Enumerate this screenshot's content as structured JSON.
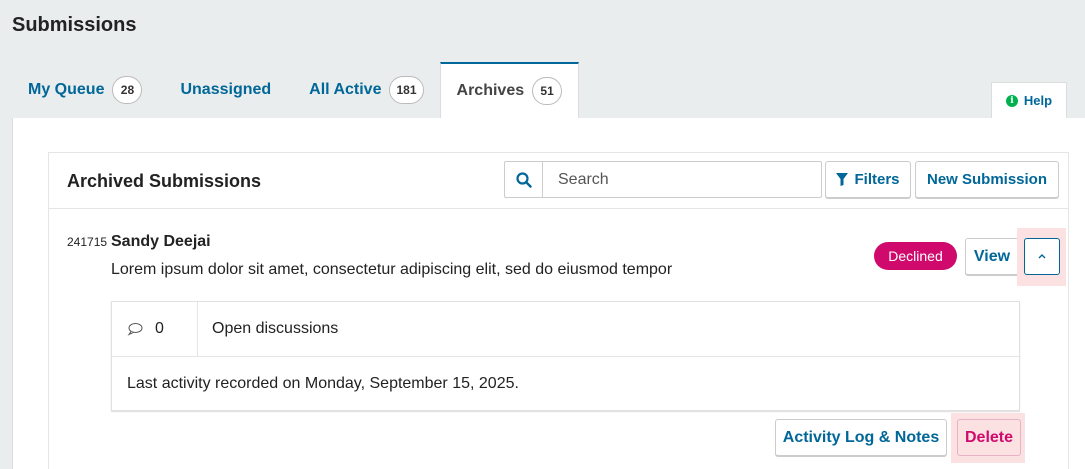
{
  "page": {
    "title": "Submissions"
  },
  "tabs": [
    {
      "label": "My Queue",
      "count": "28"
    },
    {
      "label": "Unassigned",
      "count": ""
    },
    {
      "label": "All Active",
      "count": "181"
    },
    {
      "label": "Archives",
      "count": "51",
      "active": true
    }
  ],
  "help": {
    "label": "Help",
    "icon": "info-icon"
  },
  "card": {
    "title": "Archived Submissions",
    "search": {
      "placeholder": "Search",
      "value": ""
    },
    "filters_label": "Filters",
    "new_submission_label": "New Submission"
  },
  "submission": {
    "id": "241715",
    "author": "Sandy Deejai",
    "title": "Lorem ipsum dolor sit amet, consectetur adipiscing elit, sed do eiusmod tempor",
    "status": "Declined",
    "view_label": "View",
    "discussion_count": "0",
    "discussion_label": "Open discussions",
    "last_activity": "Last activity recorded on Monday, September 15, 2025.",
    "activity_label": "Activity Log & Notes",
    "delete_label": "Delete"
  },
  "colors": {
    "link": "#006798",
    "declined": "#d00a6c",
    "highlight": "#fbe1e2",
    "help_icon": "#00b24e"
  }
}
